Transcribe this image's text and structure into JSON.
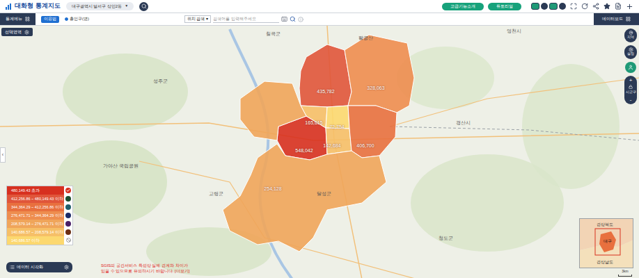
{
  "header": {
    "logo": "대화형 통계지도",
    "location": "대구광역시 달서구 상인2동",
    "location_arrow": "▼",
    "buttons": [
      "고급기능소개",
      "튜토리얼"
    ]
  },
  "toolbar": {
    "menu": "통계메뉴",
    "guide": "이용법",
    "indicator": "총인구(명)",
    "search_type": "위치 검색",
    "search_arrow": "▾",
    "search_placeholder": "검색어를 입력해주세요",
    "databoard": "데이터보드",
    "area_button": "선택영역"
  },
  "map": {
    "regions": [
      {
        "value": "548,042",
        "color": "#d7301f"
      },
      {
        "value": "435,782",
        "color": "#e0553a"
      },
      {
        "value": "328,063",
        "color": "#ee8d4f"
      },
      {
        "value": "165,615",
        "color": "#f6bf67"
      },
      {
        "value": "72,754",
        "color": "#fcd86f"
      },
      {
        "value": "142,684",
        "color": "#f6bf67"
      },
      {
        "value": "406,700",
        "color": "#e8703e"
      },
      {
        "value": "254,128",
        "color": "#f0a55a"
      }
    ],
    "places": [
      "칠곡군",
      "팔공산",
      "영천시",
      "성주군",
      "경산시",
      "가야산 국립공원",
      "고령군",
      "달성군",
      "청도군"
    ],
    "scale": "3km"
  },
  "controls": [
    "지역",
    "설정",
    "시군구",
    "+",
    "-"
  ],
  "minimap": {
    "labels": [
      "경상북도",
      "대구",
      "경상남도"
    ]
  },
  "legend": {
    "items": [
      {
        "label": "480,149.43 초과",
        "color": "#d7301f"
      },
      {
        "label": "412,256.86 ~ 480,149.43 이하",
        "color": "#e0553a"
      },
      {
        "label": "344,364.29 ~ 412,256.86 이하",
        "color": "#e8703e"
      },
      {
        "label": "276,471.71 ~ 344,364.29 이하",
        "color": "#ee8d4f"
      },
      {
        "label": "208,579.14 ~ 276,471.71 이하",
        "color": "#f0a55a"
      },
      {
        "label": "140,686.57 ~ 208,579.14 이하",
        "color": "#f6bf67"
      },
      {
        "label": "140,686.57 이하",
        "color": "#fcd86f"
      }
    ],
    "palettes": [
      {
        "color": "#d7301f",
        "selected": true
      },
      {
        "color": "#1b4d2e",
        "selected": false
      },
      {
        "color": "#1f5f6b",
        "selected": false
      },
      {
        "color": "#1d2b66",
        "selected": false
      },
      {
        "color": "#4a1f66",
        "selected": false
      },
      {
        "color": "#6b2e12",
        "selected": false
      }
    ],
    "visualize": "데이터 시각화"
  },
  "notice": [
    "SGIS의 공간서비스 특성상 실제 경계와 차이가",
    "있을 수 있으므로 유의하시기 바랍니다. [더보기]"
  ],
  "side_tab": "‹"
}
